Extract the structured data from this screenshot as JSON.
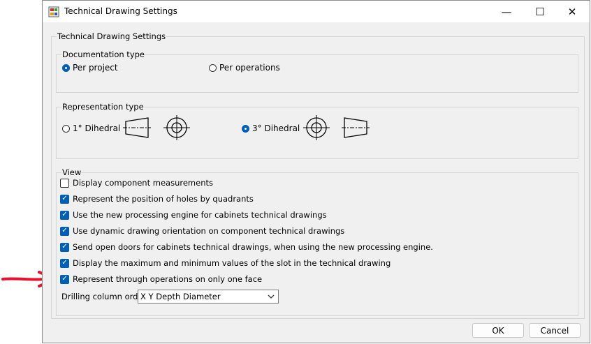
{
  "window": {
    "title": "Technical Drawing Settings",
    "minimize": "—",
    "maximize": "☐",
    "close": "✕"
  },
  "outer_group": {
    "label": "Technical Drawing Settings"
  },
  "documentation": {
    "label": "Documentation type",
    "options": [
      {
        "label": "Per project",
        "checked": true
      },
      {
        "label": "Per operations",
        "checked": false
      }
    ]
  },
  "representation": {
    "label": "Representation type",
    "options": [
      {
        "label": "1° Dihedral",
        "checked": false
      },
      {
        "label": "3° Dihedral",
        "checked": true
      }
    ]
  },
  "view": {
    "label": "View",
    "checkboxes": [
      {
        "label": "Display component measurements",
        "checked": false
      },
      {
        "label": "Represent the position of holes by quadrants",
        "checked": true
      },
      {
        "label": "Use the new processing engine for cabinets technical drawings",
        "checked": true
      },
      {
        "label": "Use dynamic drawing orientation on component technical drawings",
        "checked": true
      },
      {
        "label": "Send open doors for cabinets technical drawings, when using the new processing engine.",
        "checked": true
      },
      {
        "label": "Display the maximum and minimum values of the slot in the technical drawing",
        "checked": true
      },
      {
        "label": "Represent through operations on only one face",
        "checked": true
      }
    ],
    "drilling_label": "Drilling column order",
    "drilling_value": "X Y Depth Diameter"
  },
  "buttons": {
    "ok": "OK",
    "cancel": "Cancel"
  },
  "colors": {
    "accent": "#005fb8",
    "annotation_arrow": "#e8112d"
  }
}
